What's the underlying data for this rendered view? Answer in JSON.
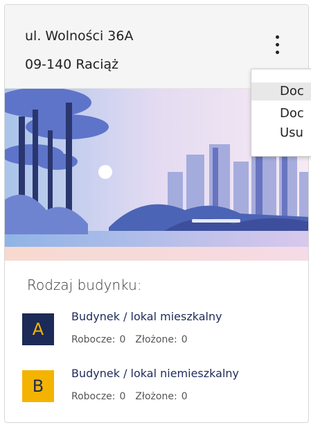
{
  "address": {
    "line1": "ul. Wolności 36A",
    "line2": "09-140 Raciąż"
  },
  "menu": {
    "icon": "kebab-menu-icon",
    "items": [
      "Doc",
      "Doc",
      "Usu"
    ]
  },
  "building_types": {
    "title": "Rodzaj budynku:",
    "items": [
      {
        "badge": "A",
        "label": "Budynek / lokal mieszkalny",
        "draft_label": "Robocze:",
        "draft_value": "0",
        "submitted_label": "Złożone:",
        "submitted_value": "0"
      },
      {
        "badge": "B",
        "label": "Budynek / lokal niemieszkalny",
        "draft_label": "Robocze:",
        "draft_value": "0",
        "submitted_label": "Złożone:",
        "submitted_value": "0"
      }
    ]
  },
  "colors": {
    "navy": "#1c2a57",
    "yellow": "#f5b301"
  }
}
